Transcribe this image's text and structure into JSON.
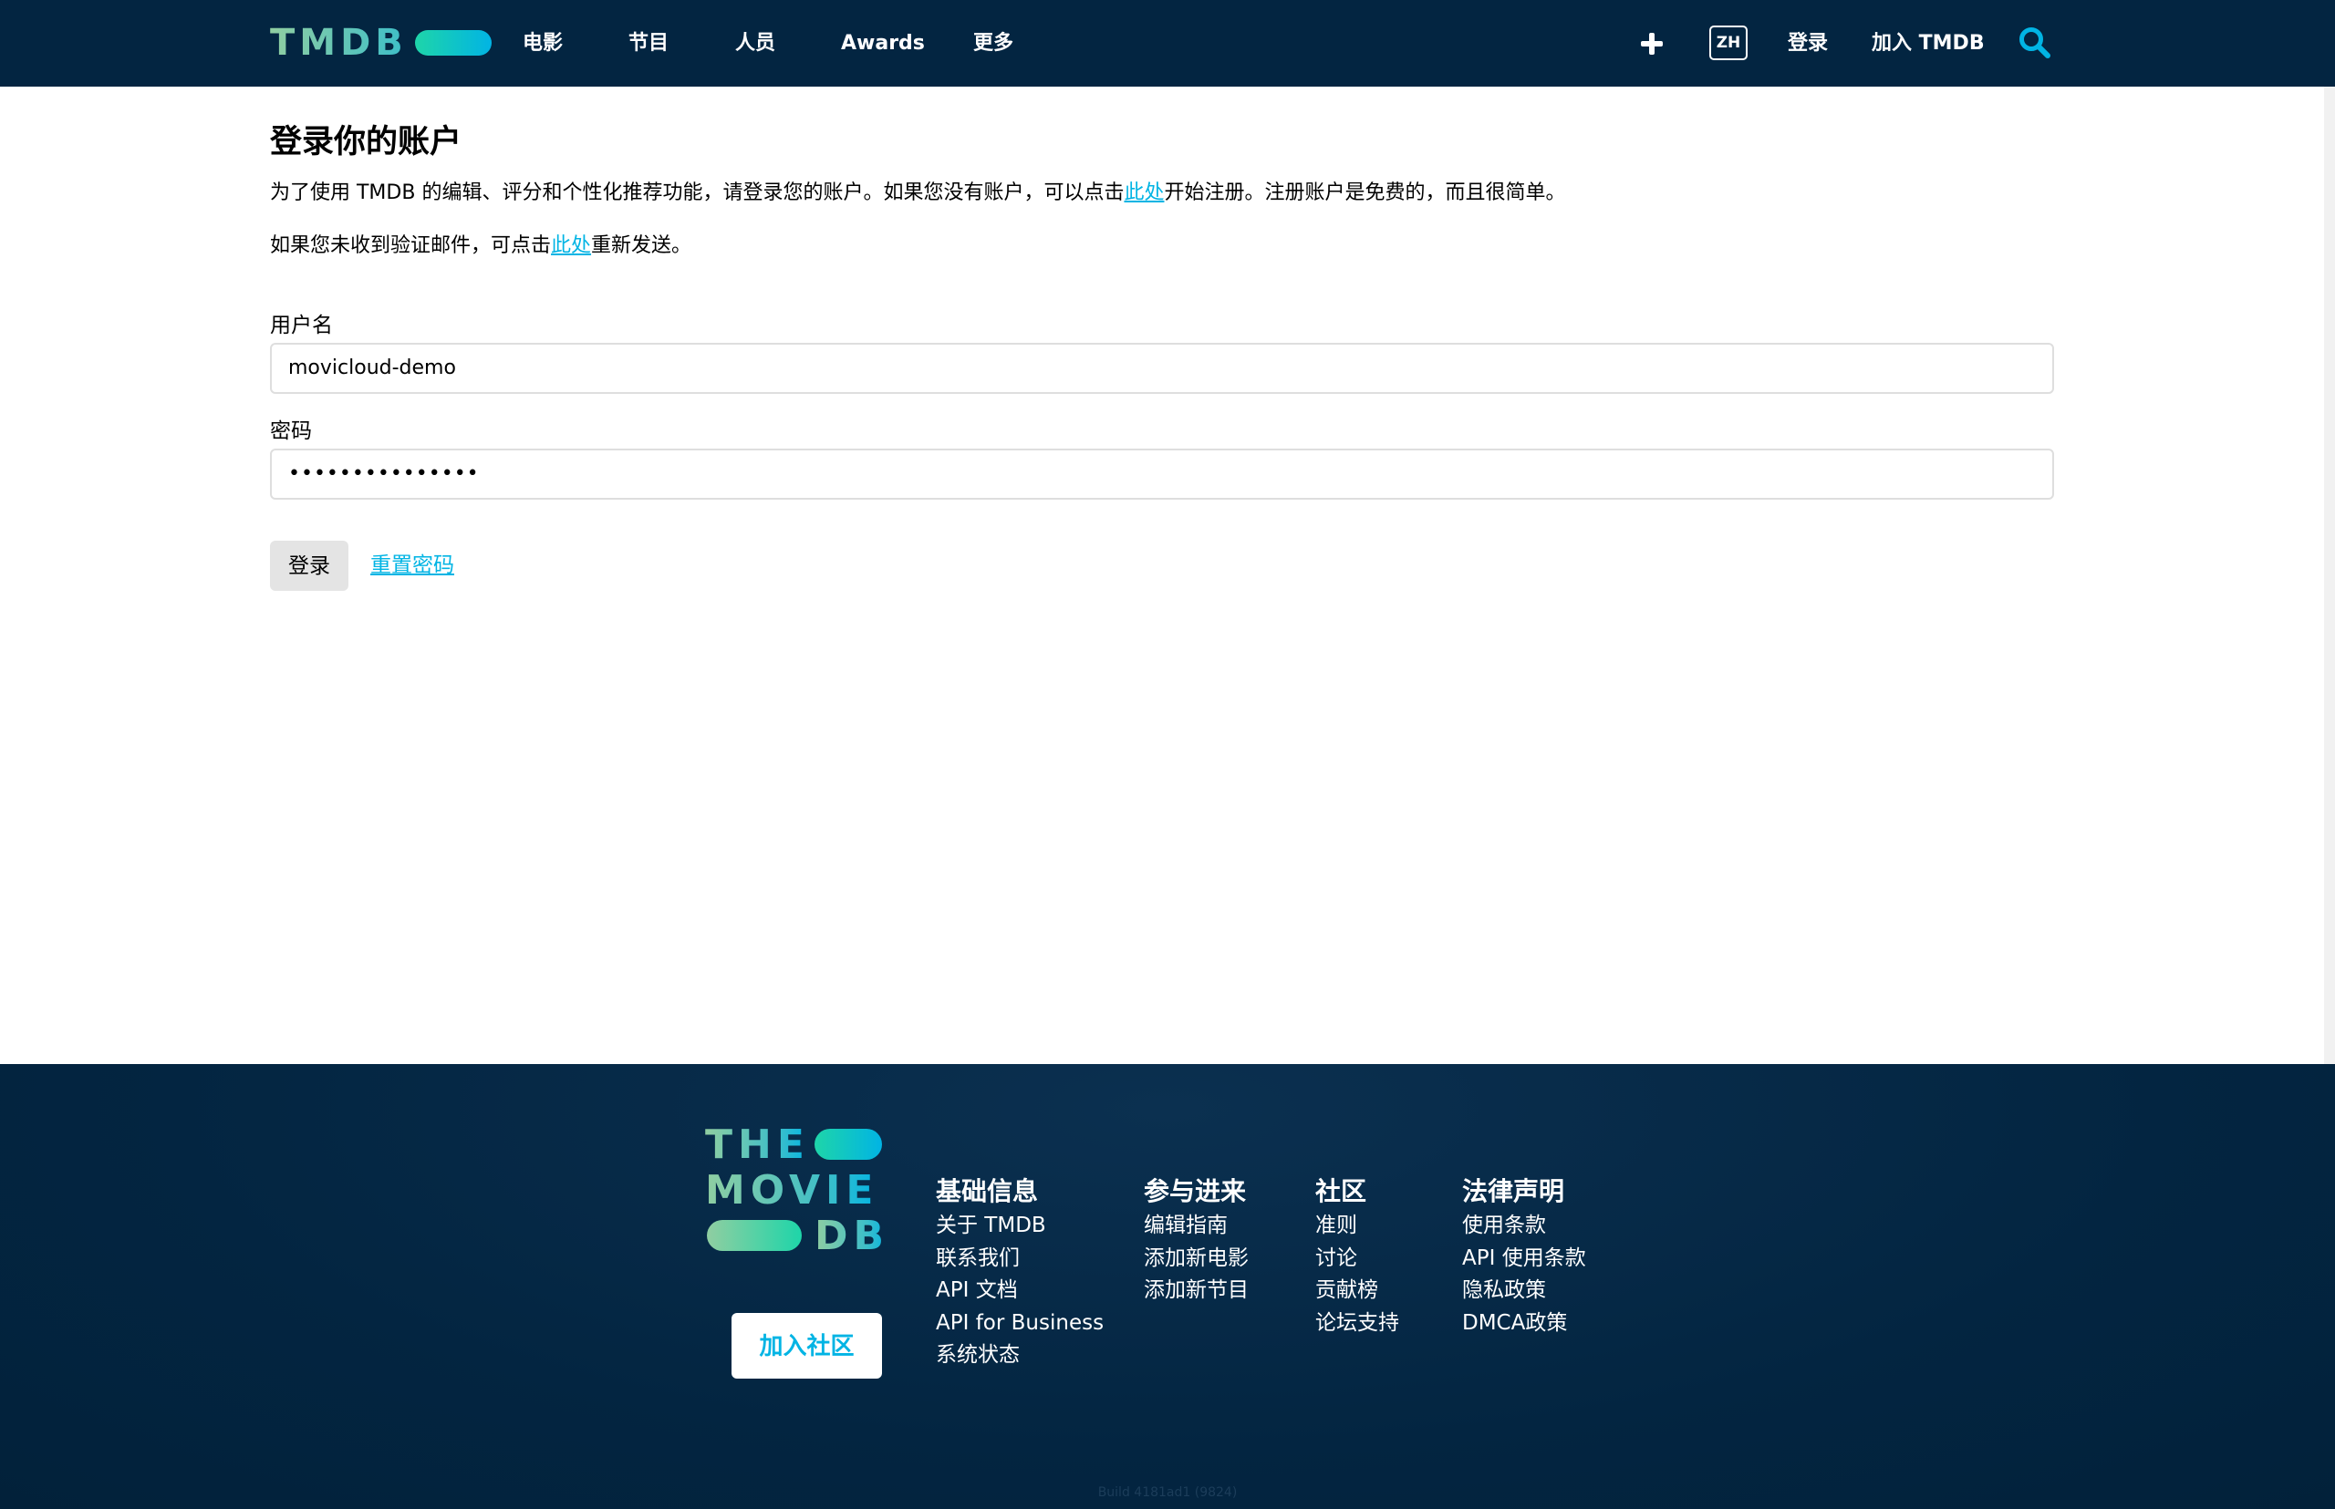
{
  "header": {
    "logo_text": "TMDB",
    "nav": [
      {
        "label": "电影"
      },
      {
        "label": "节目"
      },
      {
        "label": "人员"
      },
      {
        "label": "Awards"
      },
      {
        "label": "更多"
      }
    ],
    "add_icon": "plus-icon",
    "language": "ZH",
    "login": "登录",
    "join": "加入 TMDB",
    "search_icon": "search-icon"
  },
  "login_form": {
    "title": "登录你的账户",
    "intro_before": "为了使用 TMDB 的编辑、评分和个性化推荐功能，请登录您的账户。如果您没有账户，可以点击",
    "intro_link": "此处",
    "intro_after": "开始注册。注册账户是免费的，而且很简单。",
    "verify_before": "如果您未收到验证邮件，可点击",
    "verify_link": "此处",
    "verify_after": "重新发送。",
    "username_label": "用户名",
    "username_value": "movicloud-demo",
    "password_label": "密码",
    "password_value": "•••••••••••••••",
    "login_button": "登录",
    "reset_link": "重置密码"
  },
  "footer": {
    "logo_rows": [
      "THE",
      "MOVIE",
      "DB"
    ],
    "join_button": "加入社区",
    "columns": [
      {
        "title": "基础信息",
        "items": [
          "关于 TMDB",
          "联系我们",
          "API 文档",
          "API for Business",
          "系统状态"
        ]
      },
      {
        "title": "参与进来",
        "items": [
          "编辑指南",
          "添加新电影",
          "添加新节目"
        ]
      },
      {
        "title": "社区",
        "items": [
          "准则",
          "讨论",
          "贡献榜",
          "论坛支持"
        ]
      },
      {
        "title": "法律声明",
        "items": [
          "使用条款",
          "API 使用条款",
          "隐私政策",
          "DMCA政策"
        ]
      }
    ],
    "build": "Build 4181ad1 (9824)"
  },
  "colors": {
    "header_bg": "#032541",
    "accent": "#01b4e4",
    "logo_green": "#90cea1"
  }
}
